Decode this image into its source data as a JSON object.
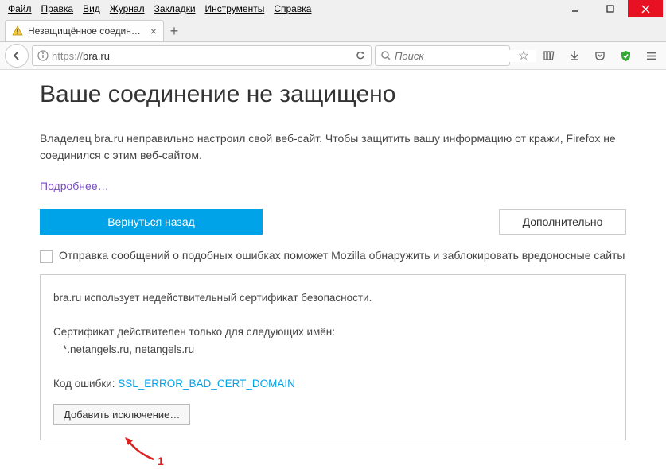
{
  "menubar": {
    "file": "Файл",
    "edit": "Правка",
    "view": "Вид",
    "history": "Журнал",
    "bookmarks": "Закладки",
    "tools": "Инструменты",
    "help": "Справка"
  },
  "tab": {
    "title": "Незащищённое соединени"
  },
  "url": {
    "scheme": "https://",
    "host": "bra.ru"
  },
  "search": {
    "placeholder": "Поиск"
  },
  "page": {
    "title": "Ваше соединение не защищено",
    "body": "Владелец bra.ru неправильно настроил свой веб-сайт. Чтобы защитить вашу информацию от кражи, Firefox не соединился с этим веб-сайтом.",
    "learn_more": "Подробнее…",
    "back_btn": "Вернуться назад",
    "advanced_btn": "Дополнительно",
    "report_label": "Отправка сообщений о подобных ошибках поможет Mozilla обнаружить и заблокировать вредоносные сайты"
  },
  "cert": {
    "line1": "bra.ru использует недействительный сертификат безопасности.",
    "line2": "Сертификат действителен только для следующих имён:",
    "names": "*.netangels.ru, netangels.ru",
    "code_label": "Код ошибки: ",
    "code": "SSL_ERROR_BAD_CERT_DOMAIN",
    "add_exception": "Добавить исключение…"
  },
  "annotation": {
    "number": "1"
  }
}
